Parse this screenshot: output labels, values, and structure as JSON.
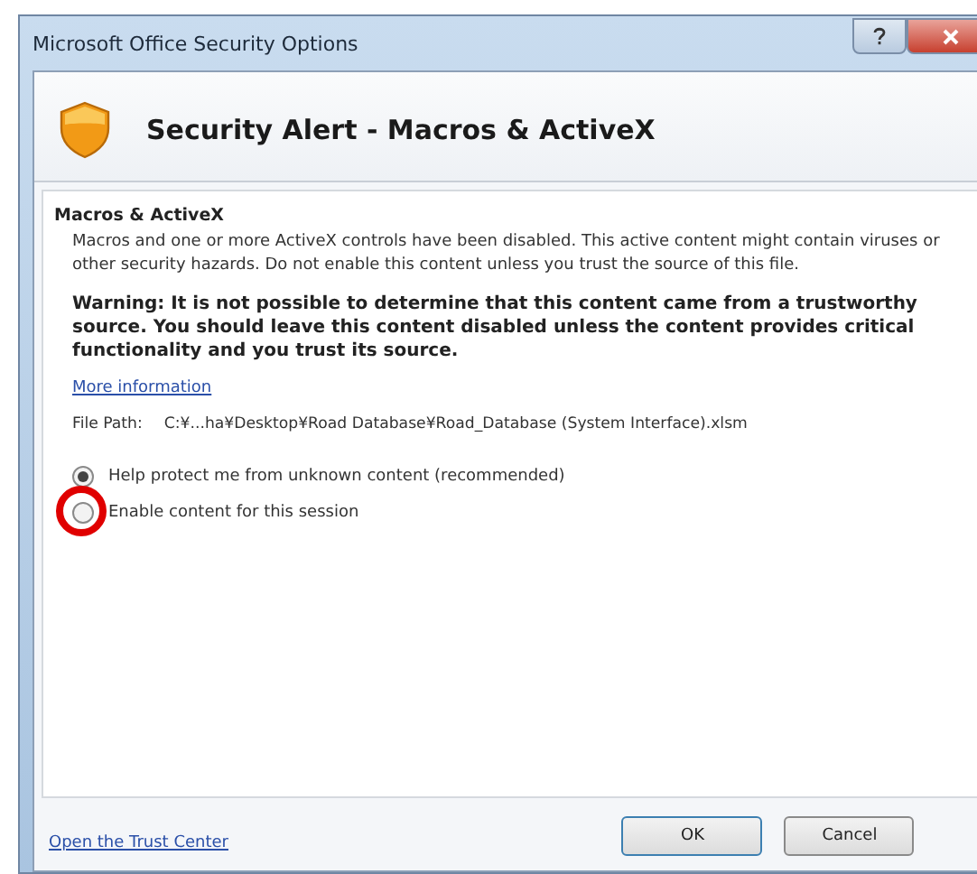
{
  "window": {
    "title": "Microsoft Office Security Options"
  },
  "header": {
    "title": "Security Alert - Macros & ActiveX"
  },
  "section": {
    "heading": "Macros & ActiveX",
    "description": "Macros and one or more ActiveX controls have been disabled. This active content might contain viruses or other security hazards. Do not enable this content unless you trust the source of this file.",
    "warning": "Warning: It is not possible to determine that this content came from a trustworthy source. You should leave this content disabled unless the content provides critical functionality and you trust its source.",
    "more_info_link": "More information",
    "file_path_label": "File Path:",
    "file_path": "C:¥...ha¥Desktop¥Road Database¥Road_Database (System Interface).xlsm"
  },
  "options": [
    {
      "label": "Help protect me from unknown content (recommended)",
      "selected": true
    },
    {
      "label": "Enable content for this session",
      "selected": false,
      "highlighted": true
    }
  ],
  "footer": {
    "link": "Open the Trust Center",
    "buttons": [
      {
        "label": "OK",
        "default": true
      },
      {
        "label": "Cancel",
        "default": false
      }
    ]
  }
}
